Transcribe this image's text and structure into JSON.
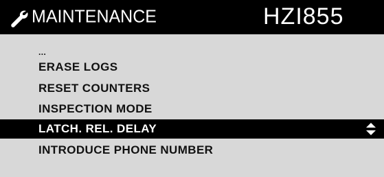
{
  "header": {
    "icon": "wrench-icon",
    "title": "MAINTENANCE",
    "device_id": "HZI855"
  },
  "menu": {
    "items": [
      {
        "label": "...",
        "selected": false
      },
      {
        "label": "ERASE LOGS",
        "selected": false
      },
      {
        "label": "RESET COUNTERS",
        "selected": false
      },
      {
        "label": "INSPECTION MODE",
        "selected": false
      },
      {
        "label": "LATCH. REL. DELAY",
        "selected": true
      },
      {
        "label": "INTRODUCE PHONE NUMBER",
        "selected": false
      }
    ],
    "selected_indicator_icon": "up-down-arrows-icon"
  },
  "colors": {
    "background": "#d8d8d8",
    "header_background": "#000000",
    "text": "#111111",
    "selected_background": "#000000",
    "selected_text": "#ffffff"
  }
}
